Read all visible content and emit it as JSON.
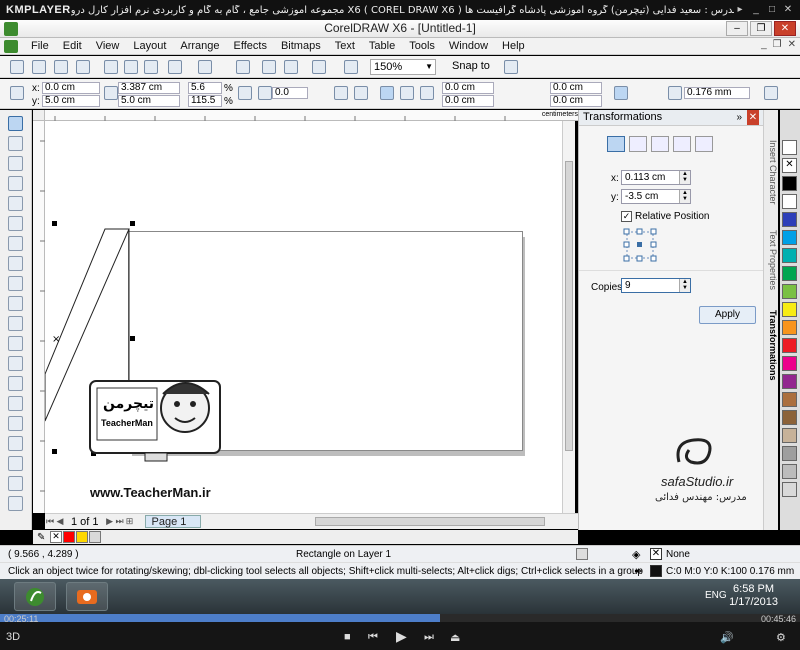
{
  "player": {
    "logo": "KMPLAYER",
    "title": "مجموعه آموزشی جامع ، گام به گام و کاربردی نرم افزار کارل درو X6 ( COREL DRAW X6 )   مدرس : سعید فدایی (تیچرمن) گروه آموزشی پادشاه گرافیست ها",
    "time_elapsed": "00:25:11",
    "time_total": "00:45:46",
    "progress": 0.55
  },
  "app": {
    "title": "CorelDRAW X6 - [Untitled-1]"
  },
  "menu": {
    "items": [
      "File",
      "Edit",
      "View",
      "Layout",
      "Arrange",
      "Effects",
      "Bitmaps",
      "Text",
      "Table",
      "Tools",
      "Window",
      "Help"
    ]
  },
  "toolbar": {
    "zoom": "150%",
    "snap_to": "Snap to"
  },
  "propbar": {
    "x_label": "x:",
    "y_label": "y:",
    "x": "0.0 cm",
    "y": "5.0 cm",
    "width": "3.387 cm",
    "height": "5.0 cm",
    "scale_x": "5.6",
    "scale_y": "115.5",
    "pct": "%",
    "rotation": "0.0",
    "corner1": "0.0 cm",
    "corner2": "0.0 cm",
    "corner3": "0.0 cm",
    "corner4": "0.0 cm",
    "outline_width": "0.176 mm"
  },
  "ruler": {
    "unit": "centimeters",
    "top_ticks": [
      "-5",
      "-4",
      "-3",
      "-2",
      "-1",
      "0",
      "1",
      "2",
      "3",
      "4",
      "5",
      "6",
      "7",
      "8",
      "9"
    ],
    "left_ticks": [
      "7",
      "6",
      "5",
      "4",
      "3",
      "2",
      "1"
    ]
  },
  "canvas": {
    "watermark_url": "www.TeacherMan.ir",
    "logo_title": "تیچرمن",
    "logo_sub": "TeacherMan",
    "safa_name": "safaStudio.ir",
    "safa_teacher": "مدرس: مهندس فدائی"
  },
  "pages": {
    "counter": "1 of 1",
    "tab": "Page 1"
  },
  "docker": {
    "title": "Transformations",
    "x_label": "x:",
    "x_value": "0.113 cm",
    "y_label": "y:",
    "y_value": "-3.5 cm",
    "relative": "Relative Position",
    "copies_label": "Copies:",
    "copies_value": "9",
    "apply": "Apply"
  },
  "vtabs": {
    "insert_character": "Insert Character",
    "text_properties": "Text Properties",
    "transformations": "Transformations"
  },
  "status": {
    "coords": "( 9.566 , 4.289 )",
    "object": "Rectangle on Layer 1",
    "fill": "None",
    "hint": "Click an object twice for rotating/skewing; dbl-clicking tool selects all objects; Shift+click multi-selects; Alt+click digs; Ctrl+click selects in a group",
    "outline": "C:0 M:0 Y:0 K:100  0.176 mm"
  },
  "taskbar": {
    "lang": "ENG",
    "time": "6:58 PM",
    "date": "1/17/2013"
  },
  "palette": {
    "bottom": [
      "#ff0000",
      "#ffd800",
      "#d9d9d9"
    ],
    "right": [
      "#ffffff",
      "#000000",
      "#2d3fb8",
      "#00a0e6",
      "#00b0b0",
      "#00a651",
      "#7ac143",
      "#f7ec13",
      "#f7941d",
      "#ed1c24",
      "#ec008c",
      "#92278f",
      "#ab6f3e",
      "#8c6239",
      "#c7b299",
      "#9e9e9e",
      "#bcbcbc",
      "#d9d9d9"
    ]
  }
}
